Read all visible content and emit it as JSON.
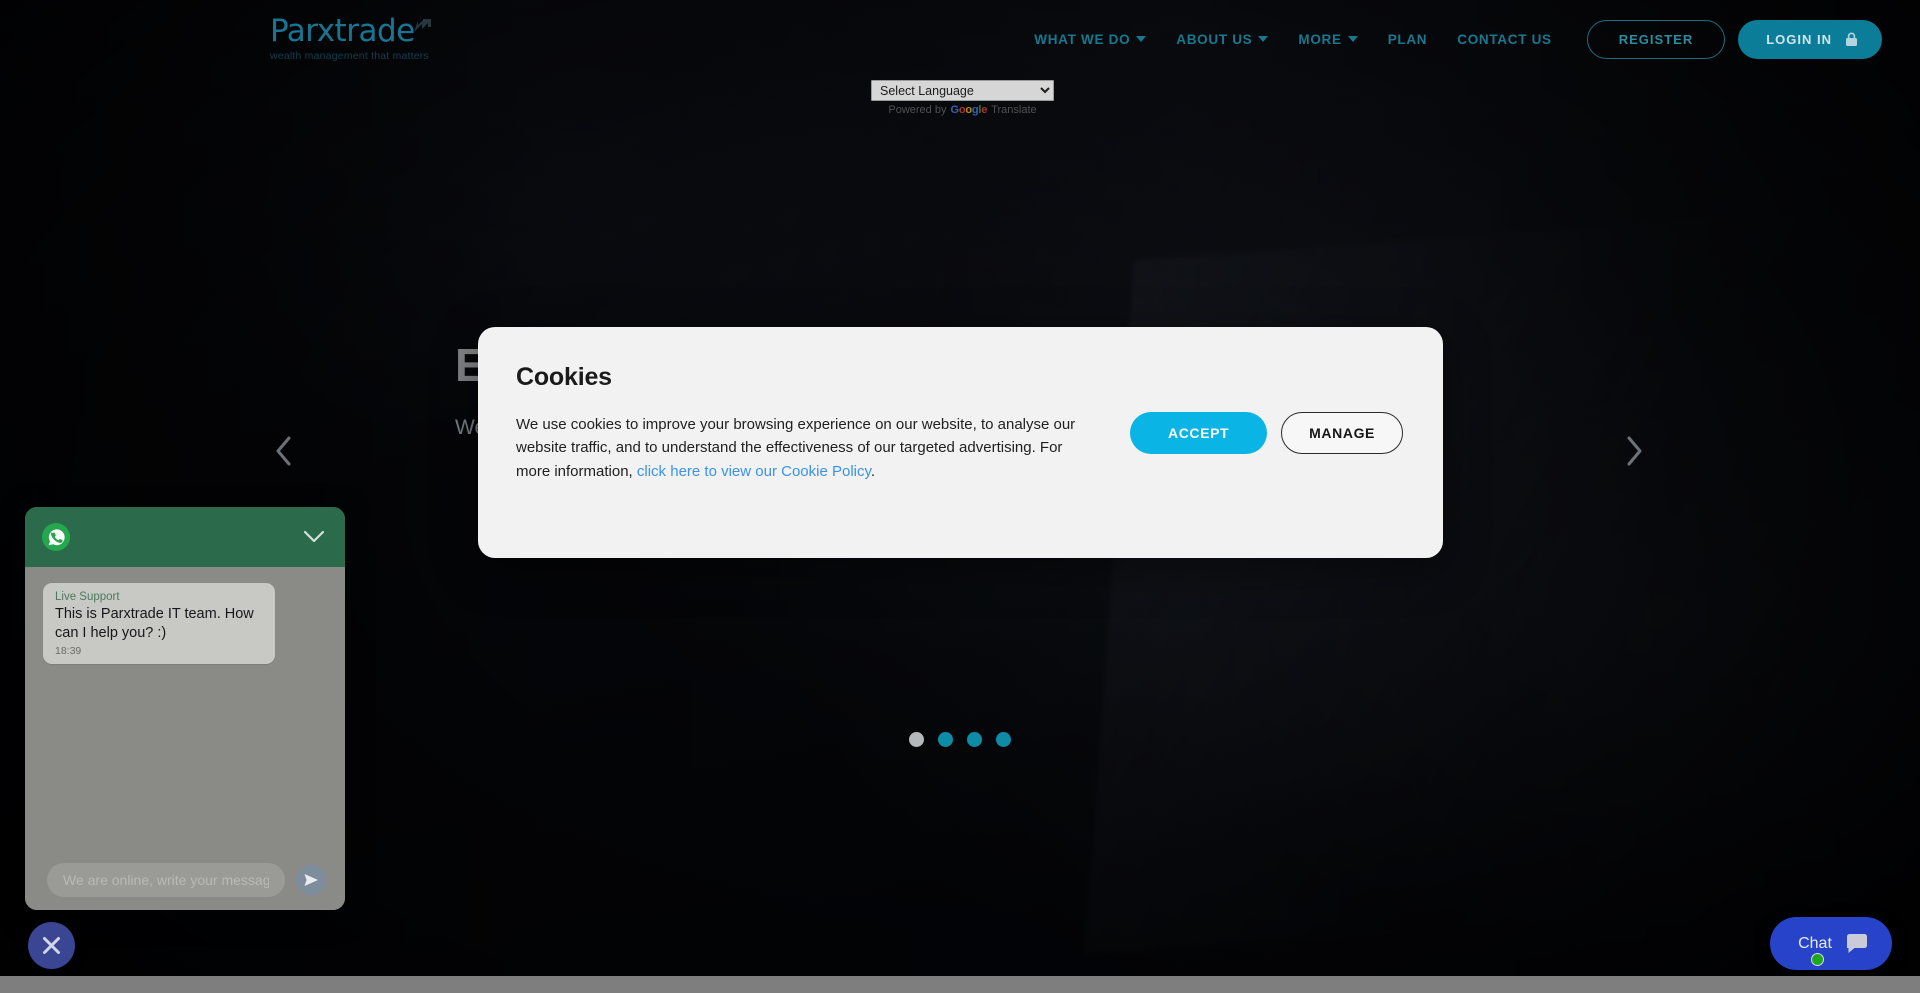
{
  "site": {
    "logo_word": "Parxtrade",
    "logo_tagline": "wealth management that matters"
  },
  "header": {
    "nav": [
      {
        "label": "WHAT WE DO",
        "has_caret": true
      },
      {
        "label": "ABOUT US",
        "has_caret": true
      },
      {
        "label": "MORE",
        "has_caret": true
      },
      {
        "label": "PLAN",
        "has_caret": false
      },
      {
        "label": "CONTACT US",
        "has_caret": false
      }
    ],
    "register_label": "REGISTER",
    "login_label": "LOGIN IN",
    "login_icon": "lock-icon",
    "accent_color": "#0c7d98",
    "nav_text_color": "#17788f"
  },
  "translate": {
    "selected": "Select Language",
    "options": [
      "Select Language"
    ],
    "powered_prefix": "Powered by",
    "google_letters": [
      "G",
      "o",
      "o",
      "g",
      "l",
      "e"
    ],
    "translate_label": "Translate"
  },
  "hero": {
    "title": "Exchange",
    "subtitle": "Wealth management for everyone, made easy.",
    "prev_icon": "chevron-left-icon",
    "next_icon": "chevron-right-icon",
    "dots": [
      {
        "active": true,
        "color": "#b5b8bb"
      },
      {
        "active": false,
        "color": "#0d8ca8"
      },
      {
        "active": false,
        "color": "#0d8ca8"
      },
      {
        "active": false,
        "color": "#0d8ca8"
      }
    ]
  },
  "cookie_modal": {
    "title": "Cookies",
    "body_part_1": "We use cookies to improve your browsing experience on our website, to analyse our website traffic, and to understand the effectiveness of our targeted advertising. For more information, ",
    "link_text": "click here to view our Cookie Policy",
    "body_part_2": ".",
    "accept_label": "ACCEPT",
    "manage_label": "MANAGE",
    "accept_color": "#0ab4e4",
    "link_color": "#3a93e8"
  },
  "whatsapp": {
    "header_icon": "whatsapp-icon",
    "collapse_icon": "chevron-down-icon",
    "header_color": "#2b6a4b",
    "message": {
      "sender": "Live Support",
      "text": "This is Parxtrade IT team. How can I help you? :)",
      "time": "18:39"
    },
    "input_placeholder": "We are online, write your message",
    "input_value": "",
    "send_icon": "send-icon"
  },
  "floating": {
    "close_icon": "close-icon",
    "chat_label": "Chat",
    "chat_icon": "chat-bubble-icon",
    "chat_color": "#2743c9",
    "online_status_color": "#1fa81f"
  }
}
